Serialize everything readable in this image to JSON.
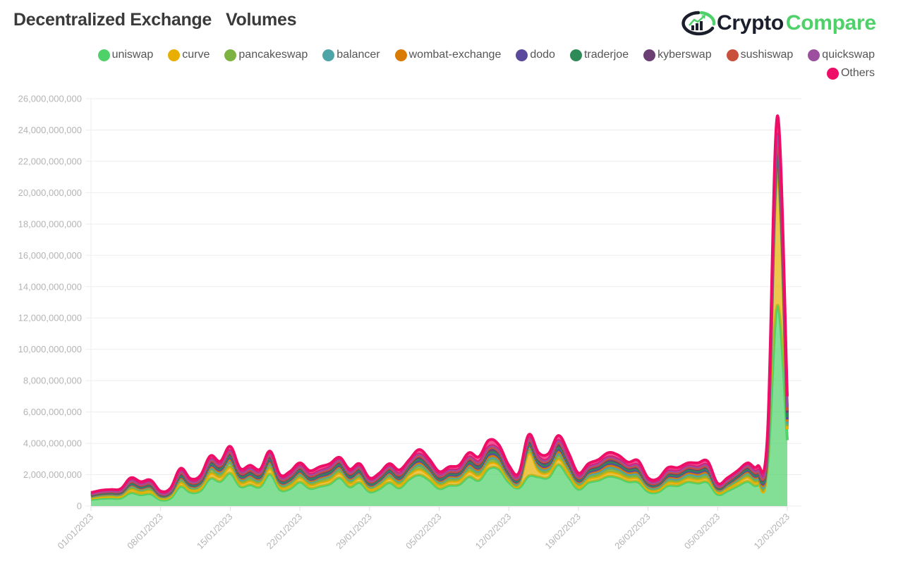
{
  "header": {
    "title": "Decentralized Exchange   Volumes",
    "brand_part1": "Crypto",
    "brand_part2": "Compare"
  },
  "colors": {
    "brand_dark": "#1b1e2b",
    "brand_green": "#4fd16a"
  },
  "chart_data": {
    "type": "area",
    "stacked": true,
    "title": "Decentralized Exchange Volumes",
    "xlabel": "",
    "ylabel": "",
    "ylim": [
      0,
      26000000000
    ],
    "yticks": [
      0,
      2000000000,
      4000000000,
      6000000000,
      8000000000,
      10000000000,
      12000000000,
      14000000000,
      16000000000,
      18000000000,
      20000000000,
      22000000000,
      24000000000,
      26000000000
    ],
    "ytick_labels": [
      "0",
      "2,000,000,000",
      "4,000,000,000",
      "6,000,000,000",
      "8,000,000,000",
      "10,000,000,000",
      "12,000,000,000",
      "14,000,000,000",
      "16,000,000,000",
      "18,000,000,000",
      "20,000,000,000",
      "22,000,000,000",
      "24,000,000,000",
      "26,000,000,000"
    ],
    "xtick_labels": [
      "01/01/2023",
      "08/01/2023",
      "15/01/2023",
      "22/01/2023",
      "29/01/2023",
      "05/02/2023",
      "12/02/2023",
      "19/02/2023",
      "26/02/2023",
      "05/03/2023",
      "12/03/2023"
    ],
    "xtick_day_index": [
      0,
      7,
      14,
      21,
      28,
      35,
      42,
      49,
      56,
      63,
      70
    ],
    "x_start": "01/01/2023",
    "x_end": "12/03/2023",
    "grid": true,
    "legend_position": "top-right",
    "totals": [
      0.85,
      1.0,
      1.05,
      1.1,
      1.8,
      1.55,
      1.65,
      0.95,
      1.15,
      2.4,
      1.75,
      1.95,
      3.2,
      2.85,
      3.8,
      2.4,
      2.6,
      2.35,
      3.5,
      2.0,
      2.2,
      2.75,
      2.25,
      2.5,
      2.7,
      3.1,
      2.35,
      2.7,
      1.8,
      2.1,
      2.7,
      2.3,
      2.95,
      3.6,
      3.0,
      2.2,
      2.5,
      2.6,
      3.4,
      3.15,
      4.2,
      3.9,
      2.6,
      2.1,
      4.55,
      3.4,
      3.35,
      4.5,
      3.4,
      2.1,
      2.7,
      2.95,
      3.4,
      3.25,
      2.8,
      2.9,
      1.8,
      1.75,
      2.45,
      2.45,
      2.75,
      2.75,
      2.85,
      1.45,
      1.8,
      2.25,
      2.75,
      2.55,
      4.5,
      24.9,
      7.0
    ],
    "series": [
      {
        "name": "uniswap",
        "color": "#4fd16a",
        "share": [
          0.48,
          0.48,
          0.48,
          0.46,
          0.47,
          0.46,
          0.47,
          0.42,
          0.44,
          0.52,
          0.5,
          0.5,
          0.55,
          0.55,
          0.55,
          0.52,
          0.52,
          0.52,
          0.58,
          0.52,
          0.5,
          0.55,
          0.5,
          0.5,
          0.52,
          0.58,
          0.52,
          0.55,
          0.5,
          0.52,
          0.55,
          0.5,
          0.58,
          0.55,
          0.55,
          0.5,
          0.52,
          0.52,
          0.55,
          0.52,
          0.58,
          0.62,
          0.6,
          0.55,
          0.42,
          0.55,
          0.55,
          0.58,
          0.55,
          0.5,
          0.55,
          0.55,
          0.55,
          0.55,
          0.55,
          0.52,
          0.5,
          0.5,
          0.52,
          0.52,
          0.55,
          0.52,
          0.52,
          0.5,
          0.52,
          0.55,
          0.55,
          0.5,
          0.52,
          0.54,
          0.6
        ]
      },
      {
        "name": "curve",
        "color": "#e8ae00",
        "share": [
          0.12,
          0.12,
          0.12,
          0.12,
          0.12,
          0.12,
          0.12,
          0.12,
          0.12,
          0.1,
          0.1,
          0.1,
          0.1,
          0.1,
          0.1,
          0.1,
          0.1,
          0.1,
          0.1,
          0.1,
          0.1,
          0.1,
          0.1,
          0.1,
          0.1,
          0.1,
          0.1,
          0.1,
          0.1,
          0.1,
          0.1,
          0.1,
          0.1,
          0.1,
          0.1,
          0.1,
          0.1,
          0.1,
          0.1,
          0.1,
          0.08,
          0.07,
          0.07,
          0.08,
          0.32,
          0.12,
          0.1,
          0.08,
          0.1,
          0.1,
          0.08,
          0.08,
          0.08,
          0.08,
          0.08,
          0.08,
          0.08,
          0.08,
          0.08,
          0.08,
          0.08,
          0.08,
          0.08,
          0.1,
          0.1,
          0.1,
          0.1,
          0.08,
          0.08,
          0.35,
          0.1
        ]
      },
      {
        "name": "pancakeswap",
        "color": "#7cb342",
        "share": [
          0.08,
          0.08,
          0.08,
          0.08,
          0.08,
          0.08,
          0.08,
          0.08,
          0.08,
          0.07,
          0.07,
          0.07,
          0.07,
          0.07,
          0.07,
          0.07,
          0.07,
          0.07,
          0.06,
          0.07,
          0.07,
          0.06,
          0.07,
          0.07,
          0.07,
          0.06,
          0.07,
          0.06,
          0.07,
          0.07,
          0.06,
          0.07,
          0.06,
          0.06,
          0.06,
          0.07,
          0.07,
          0.06,
          0.06,
          0.06,
          0.05,
          0.05,
          0.05,
          0.06,
          0.05,
          0.05,
          0.05,
          0.05,
          0.05,
          0.06,
          0.06,
          0.06,
          0.06,
          0.06,
          0.06,
          0.06,
          0.07,
          0.07,
          0.06,
          0.06,
          0.06,
          0.06,
          0.06,
          0.07,
          0.06,
          0.06,
          0.06,
          0.06,
          0.05,
          0.02,
          0.03
        ]
      },
      {
        "name": "balancer",
        "color": "#4ea5a7",
        "share": [
          0.04,
          0.04,
          0.04,
          0.04,
          0.04,
          0.04,
          0.04,
          0.04,
          0.04,
          0.03,
          0.03,
          0.03,
          0.03,
          0.03,
          0.03,
          0.03,
          0.03,
          0.03,
          0.03,
          0.03,
          0.03,
          0.03,
          0.03,
          0.03,
          0.03,
          0.03,
          0.03,
          0.03,
          0.03,
          0.03,
          0.03,
          0.03,
          0.03,
          0.03,
          0.03,
          0.03,
          0.03,
          0.03,
          0.03,
          0.03,
          0.03,
          0.03,
          0.03,
          0.03,
          0.02,
          0.03,
          0.03,
          0.03,
          0.03,
          0.03,
          0.03,
          0.03,
          0.03,
          0.03,
          0.03,
          0.03,
          0.03,
          0.03,
          0.03,
          0.03,
          0.03,
          0.03,
          0.03,
          0.03,
          0.03,
          0.03,
          0.03,
          0.03,
          0.03,
          0.01,
          0.02
        ]
      },
      {
        "name": "wombat-exchange",
        "color": "#d97b00",
        "share": [
          0.03,
          0.03,
          0.03,
          0.03,
          0.03,
          0.03,
          0.03,
          0.03,
          0.03,
          0.03,
          0.03,
          0.03,
          0.03,
          0.03,
          0.03,
          0.03,
          0.03,
          0.03,
          0.03,
          0.03,
          0.03,
          0.03,
          0.03,
          0.03,
          0.03,
          0.03,
          0.03,
          0.03,
          0.03,
          0.03,
          0.03,
          0.03,
          0.03,
          0.03,
          0.03,
          0.03,
          0.03,
          0.03,
          0.03,
          0.03,
          0.03,
          0.03,
          0.03,
          0.03,
          0.02,
          0.03,
          0.03,
          0.03,
          0.03,
          0.03,
          0.04,
          0.04,
          0.04,
          0.04,
          0.04,
          0.04,
          0.04,
          0.04,
          0.04,
          0.04,
          0.04,
          0.04,
          0.04,
          0.03,
          0.03,
          0.03,
          0.03,
          0.03,
          0.03,
          0.01,
          0.02
        ]
      },
      {
        "name": "dodo",
        "color": "#5b4a9b",
        "share": [
          0.03,
          0.03,
          0.03,
          0.03,
          0.03,
          0.03,
          0.03,
          0.03,
          0.03,
          0.03,
          0.03,
          0.03,
          0.03,
          0.03,
          0.03,
          0.03,
          0.03,
          0.03,
          0.03,
          0.03,
          0.03,
          0.03,
          0.03,
          0.03,
          0.03,
          0.03,
          0.03,
          0.03,
          0.03,
          0.03,
          0.03,
          0.03,
          0.03,
          0.03,
          0.03,
          0.03,
          0.03,
          0.03,
          0.03,
          0.03,
          0.03,
          0.03,
          0.03,
          0.03,
          0.02,
          0.03,
          0.03,
          0.03,
          0.03,
          0.03,
          0.03,
          0.03,
          0.03,
          0.03,
          0.03,
          0.03,
          0.03,
          0.03,
          0.03,
          0.03,
          0.03,
          0.03,
          0.03,
          0.03,
          0.03,
          0.03,
          0.03,
          0.03,
          0.03,
          0.01,
          0.02
        ]
      },
      {
        "name": "traderjoe",
        "color": "#2e8a56",
        "share": [
          0.03,
          0.03,
          0.03,
          0.03,
          0.03,
          0.03,
          0.03,
          0.03,
          0.03,
          0.03,
          0.03,
          0.03,
          0.03,
          0.03,
          0.03,
          0.03,
          0.03,
          0.03,
          0.03,
          0.03,
          0.03,
          0.03,
          0.03,
          0.03,
          0.03,
          0.03,
          0.03,
          0.03,
          0.03,
          0.03,
          0.03,
          0.03,
          0.03,
          0.03,
          0.03,
          0.03,
          0.03,
          0.03,
          0.03,
          0.03,
          0.03,
          0.03,
          0.03,
          0.03,
          0.02,
          0.03,
          0.03,
          0.03,
          0.03,
          0.03,
          0.03,
          0.03,
          0.03,
          0.03,
          0.03,
          0.03,
          0.03,
          0.03,
          0.03,
          0.03,
          0.03,
          0.03,
          0.03,
          0.03,
          0.03,
          0.03,
          0.03,
          0.03,
          0.03,
          0.01,
          0.02
        ]
      },
      {
        "name": "kyberswap",
        "color": "#6b3f74",
        "share": [
          0.05,
          0.05,
          0.05,
          0.05,
          0.05,
          0.05,
          0.05,
          0.05,
          0.05,
          0.05,
          0.05,
          0.05,
          0.04,
          0.04,
          0.04,
          0.05,
          0.05,
          0.05,
          0.04,
          0.05,
          0.05,
          0.04,
          0.05,
          0.05,
          0.05,
          0.04,
          0.05,
          0.04,
          0.05,
          0.05,
          0.04,
          0.05,
          0.04,
          0.04,
          0.04,
          0.05,
          0.04,
          0.04,
          0.04,
          0.04,
          0.04,
          0.04,
          0.04,
          0.04,
          0.03,
          0.04,
          0.04,
          0.04,
          0.04,
          0.04,
          0.04,
          0.04,
          0.04,
          0.04,
          0.04,
          0.04,
          0.04,
          0.04,
          0.04,
          0.04,
          0.04,
          0.04,
          0.04,
          0.04,
          0.04,
          0.04,
          0.04,
          0.04,
          0.04,
          0.02,
          0.04
        ]
      },
      {
        "name": "sushiswap",
        "color": "#c9503a",
        "share": [
          0.02,
          0.02,
          0.02,
          0.02,
          0.02,
          0.02,
          0.02,
          0.02,
          0.02,
          0.02,
          0.02,
          0.02,
          0.02,
          0.02,
          0.02,
          0.02,
          0.02,
          0.02,
          0.02,
          0.02,
          0.02,
          0.02,
          0.02,
          0.02,
          0.02,
          0.02,
          0.02,
          0.02,
          0.02,
          0.02,
          0.02,
          0.02,
          0.02,
          0.02,
          0.02,
          0.02,
          0.02,
          0.02,
          0.02,
          0.02,
          0.02,
          0.02,
          0.02,
          0.02,
          0.02,
          0.02,
          0.02,
          0.02,
          0.02,
          0.02,
          0.02,
          0.02,
          0.02,
          0.02,
          0.02,
          0.02,
          0.02,
          0.02,
          0.02,
          0.02,
          0.02,
          0.02,
          0.02,
          0.02,
          0.02,
          0.02,
          0.02,
          0.02,
          0.02,
          0.01,
          0.02
        ]
      },
      {
        "name": "quickswap",
        "color": "#9c4f9e",
        "share": [
          0.04,
          0.04,
          0.04,
          0.04,
          0.04,
          0.04,
          0.04,
          0.04,
          0.04,
          0.04,
          0.04,
          0.04,
          0.03,
          0.03,
          0.03,
          0.04,
          0.04,
          0.04,
          0.03,
          0.04,
          0.04,
          0.03,
          0.04,
          0.04,
          0.04,
          0.03,
          0.04,
          0.03,
          0.04,
          0.04,
          0.03,
          0.04,
          0.03,
          0.03,
          0.03,
          0.04,
          0.04,
          0.04,
          0.03,
          0.04,
          0.03,
          0.03,
          0.03,
          0.04,
          0.03,
          0.03,
          0.03,
          0.03,
          0.03,
          0.04,
          0.03,
          0.03,
          0.03,
          0.03,
          0.03,
          0.04,
          0.04,
          0.04,
          0.04,
          0.04,
          0.03,
          0.04,
          0.04,
          0.04,
          0.04,
          0.03,
          0.03,
          0.04,
          0.04,
          0.02,
          0.03
        ]
      },
      {
        "name": "Others",
        "color": "#ee0e68",
        "share": [
          0.08,
          0.08,
          0.08,
          0.1,
          0.09,
          0.1,
          0.09,
          0.14,
          0.12,
          0.08,
          0.1,
          0.1,
          0.07,
          0.07,
          0.07,
          0.08,
          0.08,
          0.08,
          0.05,
          0.08,
          0.1,
          0.07,
          0.1,
          0.1,
          0.08,
          0.05,
          0.08,
          0.07,
          0.09,
          0.07,
          0.07,
          0.1,
          0.05,
          0.08,
          0.08,
          0.09,
          0.08,
          0.09,
          0.08,
          0.1,
          0.1,
          0.08,
          0.1,
          0.09,
          0.05,
          0.08,
          0.1,
          0.07,
          0.1,
          0.1,
          0.08,
          0.08,
          0.08,
          0.08,
          0.08,
          0.1,
          0.1,
          0.1,
          0.09,
          0.09,
          0.07,
          0.09,
          0.09,
          0.09,
          0.07,
          0.05,
          0.05,
          0.1,
          0.09,
          0.05,
          0.1
        ]
      }
    ]
  }
}
